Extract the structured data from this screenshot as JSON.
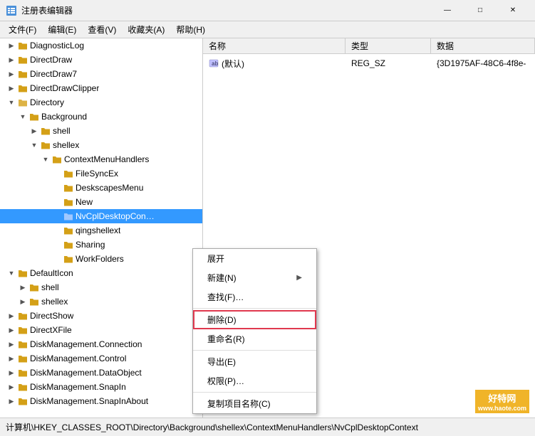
{
  "titleBar": {
    "icon": "regedit-icon",
    "title": "注册表编辑器",
    "minBtn": "—",
    "maxBtn": "□",
    "closeBtn": "✕"
  },
  "menuBar": {
    "items": [
      {
        "label": "文件(F)"
      },
      {
        "label": "编辑(E)"
      },
      {
        "label": "查看(V)"
      },
      {
        "label": "收藏夹(A)"
      },
      {
        "label": "帮助(H)"
      }
    ]
  },
  "treePane": {
    "items": [
      {
        "label": "DiagnosticLog",
        "indent": 1,
        "expanded": false,
        "hasChildren": true
      },
      {
        "label": "DirectDraw",
        "indent": 1,
        "expanded": false,
        "hasChildren": true
      },
      {
        "label": "DirectDraw7",
        "indent": 1,
        "expanded": false,
        "hasChildren": true
      },
      {
        "label": "DirectDrawClipper",
        "indent": 1,
        "expanded": false,
        "hasChildren": true
      },
      {
        "label": "Directory",
        "indent": 1,
        "expanded": true,
        "hasChildren": true
      },
      {
        "label": "Background",
        "indent": 2,
        "expanded": true,
        "hasChildren": true
      },
      {
        "label": "shell",
        "indent": 3,
        "expanded": false,
        "hasChildren": true
      },
      {
        "label": "shellex",
        "indent": 3,
        "expanded": true,
        "hasChildren": true
      },
      {
        "label": "ContextMenuHandlers",
        "indent": 4,
        "expanded": true,
        "hasChildren": true
      },
      {
        "label": "FileSyncEx",
        "indent": 5,
        "expanded": false,
        "hasChildren": false
      },
      {
        "label": "DeskscapesMenu",
        "indent": 5,
        "expanded": false,
        "hasChildren": false
      },
      {
        "label": "New",
        "indent": 5,
        "expanded": false,
        "hasChildren": false
      },
      {
        "label": "NvCplDesktopCon…",
        "indent": 5,
        "expanded": false,
        "hasChildren": false,
        "selected": true
      },
      {
        "label": "qingshellext",
        "indent": 5,
        "expanded": false,
        "hasChildren": false
      },
      {
        "label": "Sharing",
        "indent": 5,
        "expanded": false,
        "hasChildren": false
      },
      {
        "label": "WorkFolders",
        "indent": 5,
        "expanded": false,
        "hasChildren": false
      },
      {
        "label": "DefaultIcon",
        "indent": 1,
        "expanded": false,
        "hasChildren": true
      },
      {
        "label": "shell",
        "indent": 2,
        "expanded": false,
        "hasChildren": true
      },
      {
        "label": "shellex",
        "indent": 2,
        "expanded": false,
        "hasChildren": true
      },
      {
        "label": "DirectShow",
        "indent": 1,
        "expanded": false,
        "hasChildren": true
      },
      {
        "label": "DirectXFile",
        "indent": 1,
        "expanded": false,
        "hasChildren": true
      },
      {
        "label": "DiskManagement.Connection",
        "indent": 1,
        "expanded": false,
        "hasChildren": true
      },
      {
        "label": "DiskManagement.Control",
        "indent": 1,
        "expanded": false,
        "hasChildren": true
      },
      {
        "label": "DiskManagement.DataObject",
        "indent": 1,
        "expanded": false,
        "hasChildren": true
      },
      {
        "label": "DiskManagement.SnapIn",
        "indent": 1,
        "expanded": false,
        "hasChildren": true
      },
      {
        "label": "DiskManagement.SnapInAbout",
        "indent": 1,
        "expanded": false,
        "hasChildren": true
      }
    ]
  },
  "rightPane": {
    "headers": [
      {
        "label": "名称"
      },
      {
        "label": "类型"
      },
      {
        "label": "数据"
      }
    ],
    "rows": [
      {
        "name": "(默认)",
        "type": "REG_SZ",
        "data": "{3D1975AF-48C6-4f8e-",
        "isDefault": true
      }
    ]
  },
  "contextMenu": {
    "items": [
      {
        "label": "展开",
        "shortcut": "",
        "hasArrow": false
      },
      {
        "label": "新建(N)",
        "shortcut": "",
        "hasArrow": true
      },
      {
        "label": "查找(F)…",
        "shortcut": "",
        "hasArrow": false
      },
      {
        "label": "删除(D)",
        "shortcut": "",
        "hasArrow": false,
        "highlighted": true
      },
      {
        "label": "重命名(R)",
        "shortcut": "",
        "hasArrow": false
      },
      {
        "label": "导出(E)",
        "shortcut": "",
        "hasArrow": false
      },
      {
        "label": "权限(P)…",
        "shortcut": "",
        "hasArrow": false
      },
      {
        "label": "复制项目名称(C)",
        "shortcut": "",
        "hasArrow": false
      }
    ]
  },
  "statusBar": {
    "text": "计算机\\HKEY_CLASSES_ROOT\\Directory\\Background\\shellex\\ContextMenuHandlers\\NvCplDesktopContext"
  },
  "watermark": {
    "line1": "好特网",
    "url": "www.haote.com"
  }
}
